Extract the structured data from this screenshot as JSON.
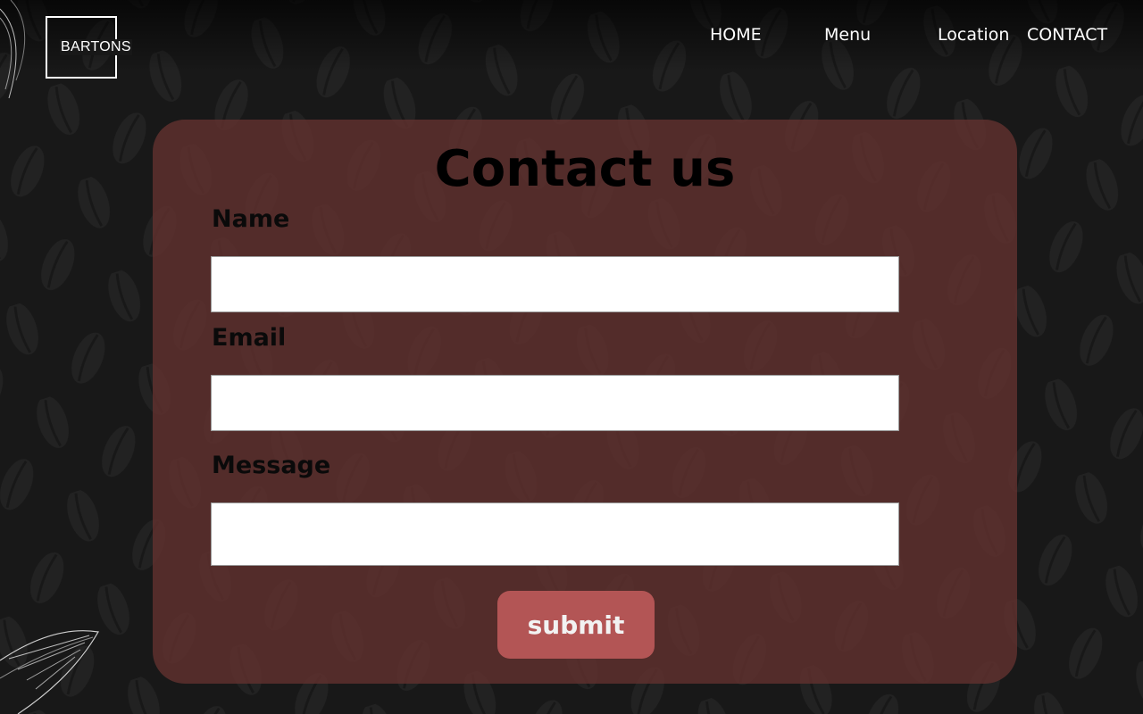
{
  "brand": {
    "logo_text": "BARTONS"
  },
  "nav": {
    "items": [
      "HOME",
      "Menu",
      "Location",
      "CONTACT"
    ]
  },
  "contact_form": {
    "title": "Contact us",
    "fields": {
      "name": {
        "label": "Name",
        "value": ""
      },
      "email": {
        "label": "Email",
        "value": ""
      },
      "message": {
        "label": "Message",
        "value": ""
      }
    },
    "submit_label": "submit"
  },
  "colors": {
    "background": "#181818",
    "card": "#643230",
    "submit_button": "#b35555",
    "nav_text": "#ffffff"
  },
  "icons": {
    "background_pattern": "coffee-bean-pattern",
    "decoration": "leaf-outline"
  }
}
